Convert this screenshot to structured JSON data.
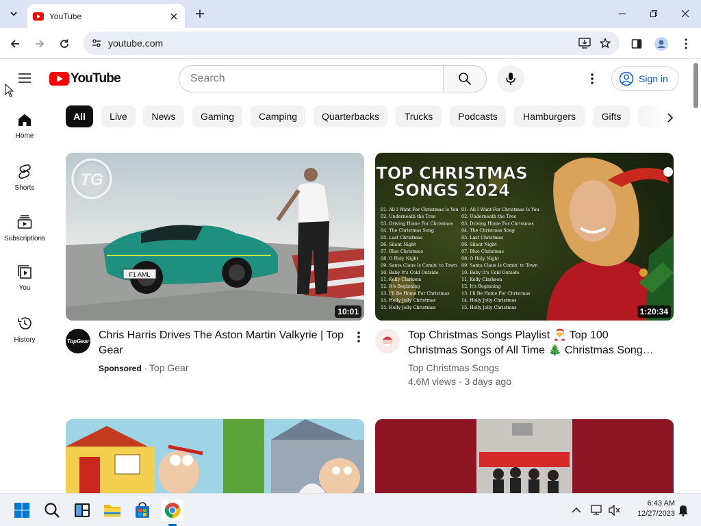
{
  "browser": {
    "tab_title": "YouTube",
    "url": "youtube.com"
  },
  "youtube": {
    "logo_text": "YouTube",
    "search_placeholder": "Search",
    "signin_label": "Sign in"
  },
  "guide": [
    {
      "label": "Home",
      "icon": "home-icon"
    },
    {
      "label": "Shorts",
      "icon": "shorts-icon"
    },
    {
      "label": "Subscriptions",
      "icon": "subscriptions-icon"
    },
    {
      "label": "You",
      "icon": "you-icon"
    },
    {
      "label": "History",
      "icon": "history-icon"
    }
  ],
  "chips": [
    "All",
    "Live",
    "News",
    "Gaming",
    "Camping",
    "Quarterbacks",
    "Trucks",
    "Podcasts",
    "Hamburgers",
    "Gifts"
  ],
  "videos": [
    {
      "title": "Chris Harris Drives The Aston Martin Valkyrie | Top Gear",
      "sponsored": "Sponsored",
      "channel": "Top Gear",
      "duration": "10:01",
      "thumb_badge": "TG",
      "plate": "F1 AML"
    },
    {
      "title": "Top Christmas Songs Playlist 🎅 Top 100 Christmas Songs of All Time 🎄 Christmas Song…",
      "channel": "Top Christmas Songs",
      "views": "4.6M views",
      "age": "3 days ago",
      "duration": "1:20:34",
      "thumb_title": "TOP CHRISTMAS SONGS 2024",
      "tracklist": [
        "01. All I Want For Christmas Is You",
        "02. Underneath the Tree",
        "03. Driving Home For Christmas",
        "04. The Christmas Song",
        "05. Last Christmas",
        "06. Silent Night",
        "07. Blue Christmas",
        "08. O Holy Night",
        "09. Santa Claus Is Comin' to Town",
        "10. Baby It's Cold Outside",
        "11. Kelly Clarkson",
        "12. It's Beginning",
        "13. I'll Be Home For Christmas",
        "14. Holly Jolly Christmas",
        "15. Holly Jolly Christmas"
      ]
    }
  ],
  "taskbar": {
    "time": "6:43 AM",
    "date": "12/27/2023"
  }
}
